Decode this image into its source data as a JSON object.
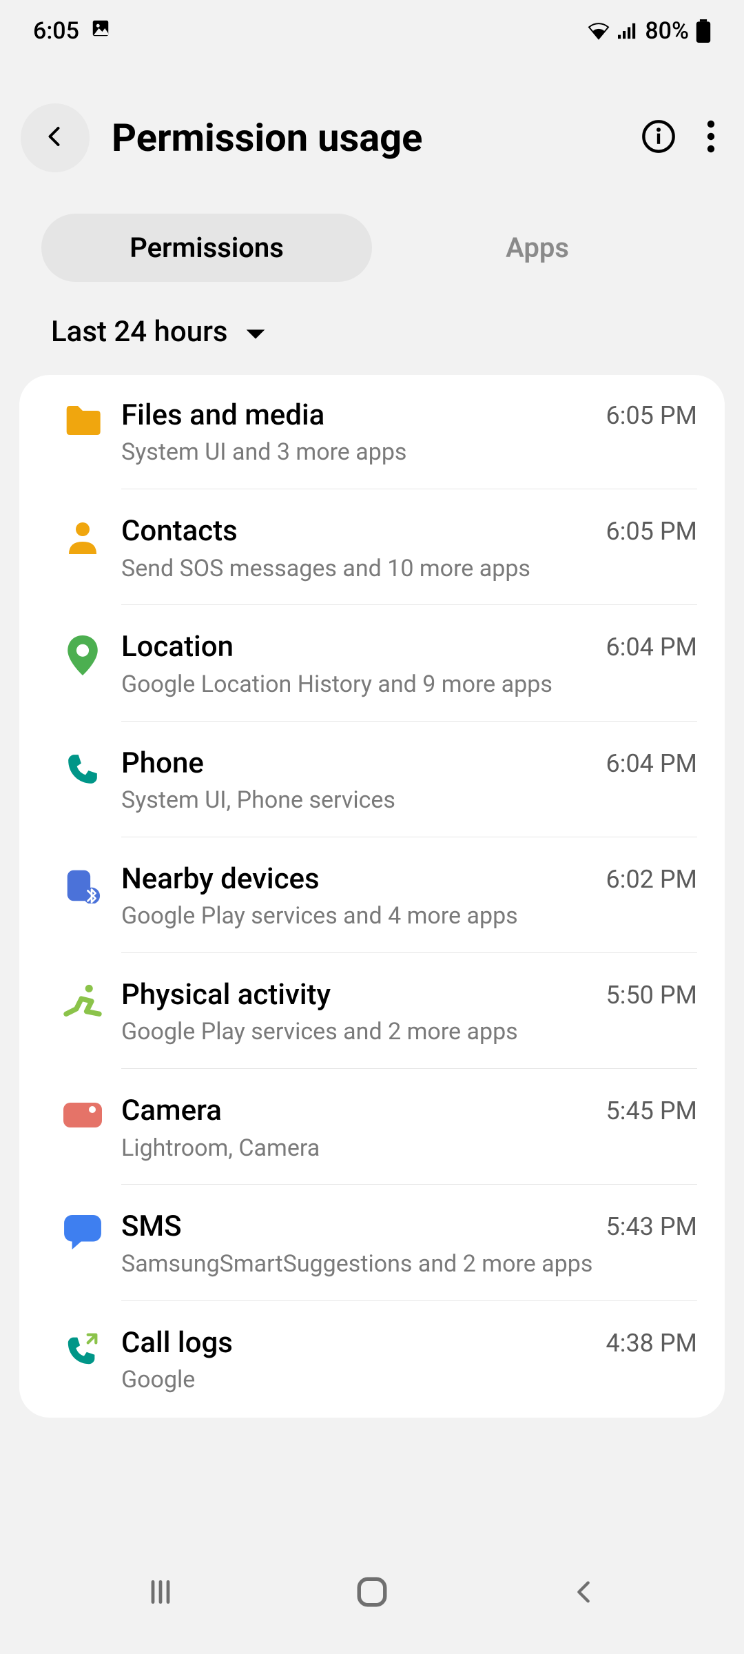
{
  "status": {
    "time": "6:05",
    "battery": "80%"
  },
  "header": {
    "title": "Permission usage"
  },
  "tabs": {
    "permissions": "Permissions",
    "apps": "Apps"
  },
  "filter": {
    "label": "Last 24 hours"
  },
  "colors": {
    "files": "#f0a60e",
    "contacts": "#f0a60e",
    "location": "#4caf50",
    "phone": "#009688",
    "nearby": "#4b72d9",
    "activity": "#8bc34a",
    "camera": "#e57368",
    "sms": "#3e7ff0",
    "calllogs": "#009688"
  },
  "rows": [
    {
      "icon": "folder",
      "title": "Files and media",
      "time": "6:05 PM",
      "sub": "System UI and 3 more apps"
    },
    {
      "icon": "contacts",
      "title": "Contacts",
      "time": "6:05 PM",
      "sub": "Send SOS messages and 10 more apps"
    },
    {
      "icon": "location",
      "title": "Location",
      "time": "6:04 PM",
      "sub": "Google Location History and 9 more apps"
    },
    {
      "icon": "phone",
      "title": "Phone",
      "time": "6:04 PM",
      "sub": "System UI, Phone services"
    },
    {
      "icon": "nearby",
      "title": "Nearby devices",
      "time": "6:02 PM",
      "sub": "Google Play services and 4 more apps"
    },
    {
      "icon": "activity",
      "title": "Physical activity",
      "time": "5:50 PM",
      "sub": "Google Play services and 2 more apps"
    },
    {
      "icon": "camera",
      "title": "Camera",
      "time": "5:45 PM",
      "sub": "Lightroom, Camera"
    },
    {
      "icon": "sms",
      "title": "SMS",
      "time": "5:43 PM",
      "sub": "SamsungSmartSuggestions and 2 more apps"
    },
    {
      "icon": "calllogs",
      "title": "Call logs",
      "time": "4:38 PM",
      "sub": "Google"
    }
  ]
}
